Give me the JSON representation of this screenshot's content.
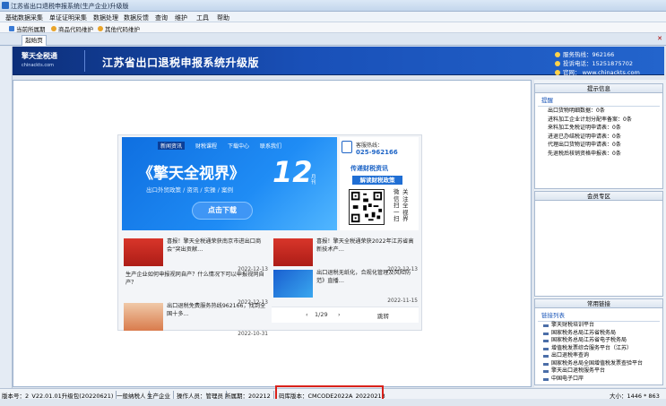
{
  "window": {
    "title": "江苏省出口退税申报系统(生产企业)升级版"
  },
  "menu": [
    "基础数据采集",
    "单证证明采集",
    "数据处理",
    "数据反馈",
    "查询",
    "维护",
    "工具",
    "帮助"
  ],
  "toolbar": [
    "当前所属期",
    "商品代码维护",
    "其他代码维护"
  ],
  "tab": {
    "label": "起始页"
  },
  "banner": {
    "logo": "擎天全税通",
    "logo_sub": "chinackts.com",
    "title": "江苏省出口退税申报系统升级版",
    "hotline": "服务热线：962166",
    "complaint": "投诉电话：15251875702",
    "website": "官网：   www.chinackts.com"
  },
  "ad": {
    "nav": [
      "新闻资讯",
      "财税课程",
      "下载中心",
      "联系我们"
    ],
    "headline": "《擎天全视界》",
    "month_number": "12",
    "month_unit": "月刊",
    "subline": "出口外贸政策 / 资讯 / 实操 / 案例",
    "download_button": "点击下载",
    "hotline_label": "客服热线：",
    "hotline_number": "025-962166",
    "slogan1": "传递财税资讯",
    "slogan2": "解读财税政策",
    "follow_col1": "微信扫一扫",
    "follow_col2": "关注全视界"
  },
  "news": [
    {
      "text": "喜报！擎天全税通荣获南京市进出口商会“突出贡献…",
      "date": "2022-12-13"
    },
    {
      "text": "喜报！擎天全税通荣获2022年江苏省高新技术产…",
      "date": "2022-12-13"
    },
    {
      "text": "生产企业如何申报视同自产？什么情况下可以申报视同自产？",
      "date": "2022-12-13"
    },
    {
      "text": "出口退税无纸化，合规化管理及风险防范》直播…",
      "date": "2022-11-15"
    },
    {
      "text": "出口退税免费服务热线962166，找到全国十多…",
      "date": "2022-10-31"
    }
  ],
  "pager": {
    "page": "1/29",
    "goto": "跳转"
  },
  "panels": {
    "tips": {
      "header": "提示信息",
      "sub": "提醒",
      "lines": [
        "出口货物明细数据：0条",
        "进料加工企业计划分配率备案：0条",
        "来料加工免税证明申请表：0条",
        "进退已办结税证明申请表：0条",
        "代理出口货物证明申请表：0条",
        "先退税后核销资格申报表：0条"
      ]
    },
    "member": {
      "header": "会员专区"
    },
    "links": {
      "header": "常用链接",
      "sub": "链接列表",
      "items": [
        "擎天财税培训平台",
        "国家税务总局江苏省税务局",
        "国家税务总局江苏省电子税务局",
        "增值税发票综合服务平台（江苏）",
        "出口退税率查询",
        "国家税务总局全国增值税发票查验平台",
        "擎天出口退税服务平台",
        "中国电子口岸"
      ]
    }
  },
  "status": {
    "version": "版本号：2_V22.01.01升级包(20220621)",
    "taxpayer_type": "一般纳税人",
    "enterprise_type": "生产企业",
    "operator": "操作人员：管理员",
    "period": "所属期：202212",
    "code_library": "码库版本：CMCODE2022A_20220213",
    "size": "大小：1446 * 863"
  }
}
